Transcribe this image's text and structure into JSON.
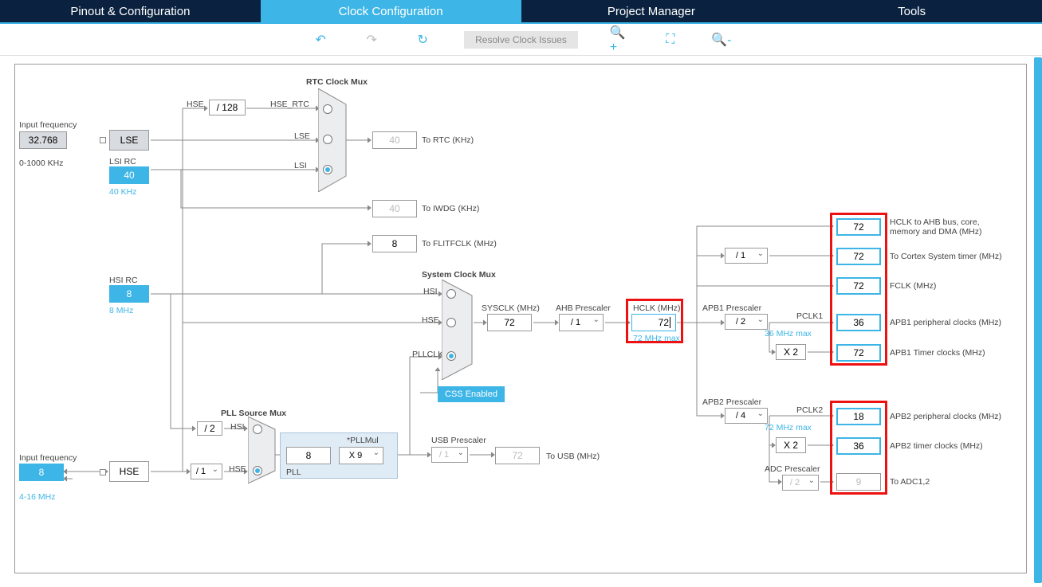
{
  "tabs": [
    "Pinout & Configuration",
    "Clock Configuration",
    "Project Manager",
    "Tools"
  ],
  "toolbar": {
    "resolve": "Resolve Clock Issues"
  },
  "inputFreq1": {
    "label": "Input frequency",
    "value": "32.768",
    "range": "0-1000 KHz"
  },
  "lse": "LSE",
  "lsirc": {
    "label": "LSI RC",
    "value": "40",
    "note": "40 KHz"
  },
  "rtcmux": {
    "title": "RTC Clock Mux",
    "hse": "HSE",
    "div": "/ 128",
    "hsertc": "HSE_RTC",
    "lse": "LSE",
    "lsi": "LSI"
  },
  "toRtc": {
    "value": "40",
    "label": "To RTC (KHz)"
  },
  "toIwdg": {
    "value": "40",
    "label": "To IWDG (KHz)"
  },
  "toFlitf": {
    "value": "8",
    "label": "To FLITFCLK (MHz)"
  },
  "hsirc": {
    "label": "HSI RC",
    "value": "8",
    "note": "8 MHz"
  },
  "inputFreq2": {
    "label": "Input frequency",
    "value": "8",
    "range": "4-16 MHz"
  },
  "hse": "HSE",
  "hseDiv": "/ 1",
  "pllsrc": {
    "title": "PLL Source Mux",
    "div2": "/ 2",
    "hsi": "HSI",
    "hse": "HSE"
  },
  "pll": {
    "title": "PLL",
    "mulLabel": "*PLLMul",
    "value": "8",
    "mul": "X 9"
  },
  "sysmux": {
    "title": "System Clock Mux",
    "hsi": "HSI",
    "hse": "HSE",
    "pllclk": "PLLCLK"
  },
  "css": "CSS Enabled",
  "usb": {
    "label": "USB Prescaler",
    "div": "/ 1",
    "value": "72",
    "out": "To USB (MHz)"
  },
  "sysclk": {
    "label": "SYSCLK (MHz)",
    "value": "72"
  },
  "ahb": {
    "label": "AHB Prescaler",
    "div": "/ 1"
  },
  "hclk": {
    "label": "HCLK (MHz)",
    "value": "72",
    "note": "72 MHz max"
  },
  "apb1": {
    "label": "APB1 Prescaler",
    "div": "/ 2",
    "note": "36 MHz max",
    "pclk": "PCLK1",
    "mul": "X 2"
  },
  "apb2": {
    "label": "APB2 Prescaler",
    "div": "/ 4",
    "note": "72 MHz max",
    "pclk": "PCLK2",
    "mul": "X 2"
  },
  "adc": {
    "label": "ADC Prescaler",
    "div": "/ 2"
  },
  "cortexDiv": "/ 1",
  "outputs": {
    "hclkAhb": {
      "value": "72",
      "label": "HCLK to AHB bus, core, memory and DMA (MHz)"
    },
    "cortex": {
      "value": "72",
      "label": "To Cortex System timer (MHz)"
    },
    "fclk": {
      "value": "72",
      "label": "FCLK (MHz)"
    },
    "apb1p": {
      "value": "36",
      "label": "APB1 peripheral clocks (MHz)"
    },
    "apb1t": {
      "value": "72",
      "label": "APB1 Timer clocks (MHz)"
    },
    "apb2p": {
      "value": "18",
      "label": "APB2 peripheral clocks (MHz)"
    },
    "apb2t": {
      "value": "36",
      "label": "APB2 timer clocks (MHz)"
    },
    "adc": {
      "value": "9",
      "label": "To ADC1,2"
    }
  }
}
